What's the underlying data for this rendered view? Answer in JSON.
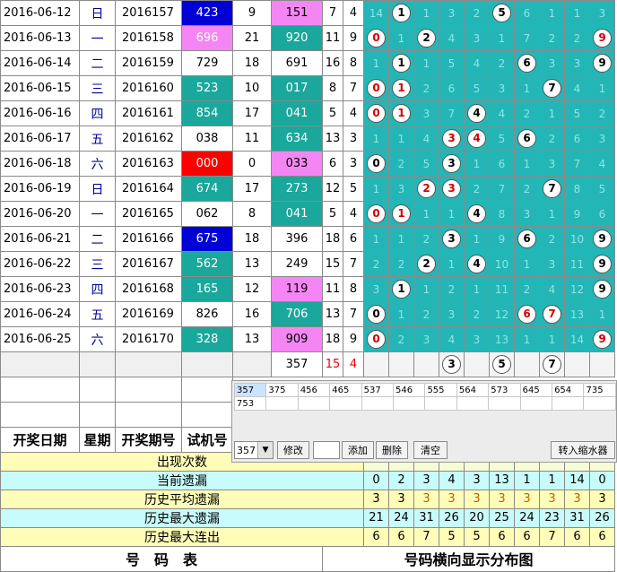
{
  "rows": [
    {
      "date": "2016-06-12",
      "week": "日",
      "issue": "2016157",
      "test": "423",
      "test_bg": "blue",
      "span": "9",
      "result": "151",
      "result_bg": "pink",
      "sum": "7",
      "hz": "4",
      "dist": [
        {
          "v": "14"
        },
        {
          "v": "1",
          "ball": true
        },
        {
          "v": "1"
        },
        {
          "v": "3"
        },
        {
          "v": "2"
        },
        {
          "v": "5",
          "ball": true
        },
        {
          "v": "6"
        },
        {
          "v": "1"
        },
        {
          "v": "1"
        },
        {
          "v": "3"
        }
      ]
    },
    {
      "date": "2016-06-13",
      "week": "一",
      "issue": "2016158",
      "test": "696",
      "test_bg": "pink",
      "span": "21",
      "result": "920",
      "result_bg": "teal",
      "sum": "11",
      "hz": "9",
      "dist": [
        {
          "v": "0",
          "ball": true,
          "red": true
        },
        {
          "v": "1"
        },
        {
          "v": "2",
          "ball": true
        },
        {
          "v": "4"
        },
        {
          "v": "3"
        },
        {
          "v": "1"
        },
        {
          "v": "7"
        },
        {
          "v": "2"
        },
        {
          "v": "2"
        },
        {
          "v": "9",
          "ball": true,
          "red": true
        }
      ]
    },
    {
      "date": "2016-06-14",
      "week": "二",
      "issue": "2016159",
      "test": "729",
      "test_bg": "white",
      "span": "18",
      "result": "691",
      "result_bg": "white",
      "sum": "16",
      "hz": "8",
      "dist": [
        {
          "v": "1"
        },
        {
          "v": "1",
          "ball": true
        },
        {
          "v": "1"
        },
        {
          "v": "5"
        },
        {
          "v": "4"
        },
        {
          "v": "2"
        },
        {
          "v": "6",
          "ball": true
        },
        {
          "v": "3"
        },
        {
          "v": "3"
        },
        {
          "v": "9",
          "ball": true
        }
      ]
    },
    {
      "date": "2016-06-15",
      "week": "三",
      "issue": "2016160",
      "test": "523",
      "test_bg": "teal",
      "span": "10",
      "result": "017",
      "result_bg": "teal",
      "sum": "8",
      "hz": "7",
      "dist": [
        {
          "v": "0",
          "ball": true,
          "red": true
        },
        {
          "v": "1",
          "ball": true,
          "red": true
        },
        {
          "v": "2"
        },
        {
          "v": "6"
        },
        {
          "v": "5"
        },
        {
          "v": "3"
        },
        {
          "v": "1"
        },
        {
          "v": "7",
          "ball": true
        },
        {
          "v": "4"
        },
        {
          "v": "1"
        }
      ]
    },
    {
      "date": "2016-06-16",
      "week": "四",
      "issue": "2016161",
      "test": "854",
      "test_bg": "teal",
      "span": "17",
      "result": "041",
      "result_bg": "teal",
      "sum": "5",
      "hz": "4",
      "dist": [
        {
          "v": "0",
          "ball": true,
          "red": true
        },
        {
          "v": "1",
          "ball": true,
          "red": true
        },
        {
          "v": "3"
        },
        {
          "v": "7"
        },
        {
          "v": "4",
          "ball": true
        },
        {
          "v": "4"
        },
        {
          "v": "2"
        },
        {
          "v": "1"
        },
        {
          "v": "5"
        },
        {
          "v": "2"
        }
      ]
    },
    {
      "date": "2016-06-17",
      "week": "五",
      "issue": "2016162",
      "test": "038",
      "test_bg": "white",
      "span": "11",
      "result": "634",
      "result_bg": "teal",
      "sum": "13",
      "hz": "3",
      "dist": [
        {
          "v": "1"
        },
        {
          "v": "1"
        },
        {
          "v": "4"
        },
        {
          "v": "3",
          "ball": true,
          "red": true
        },
        {
          "v": "4",
          "ball": true,
          "red": true
        },
        {
          "v": "5"
        },
        {
          "v": "6",
          "ball": true
        },
        {
          "v": "2"
        },
        {
          "v": "6"
        },
        {
          "v": "3"
        }
      ]
    },
    {
      "date": "2016-06-18",
      "week": "六",
      "issue": "2016163",
      "test": "000",
      "test_bg": "red",
      "span": "0",
      "result": "033",
      "result_bg": "pink",
      "sum": "6",
      "hz": "3",
      "dist": [
        {
          "v": "0",
          "ball": true
        },
        {
          "v": "2"
        },
        {
          "v": "5"
        },
        {
          "v": "3",
          "ball": true
        },
        {
          "v": "1"
        },
        {
          "v": "6"
        },
        {
          "v": "1"
        },
        {
          "v": "3"
        },
        {
          "v": "7"
        },
        {
          "v": "4"
        }
      ]
    },
    {
      "date": "2016-06-19",
      "week": "日",
      "issue": "2016164",
      "test": "674",
      "test_bg": "teal",
      "span": "17",
      "result": "273",
      "result_bg": "teal",
      "sum": "12",
      "hz": "5",
      "dist": [
        {
          "v": "1"
        },
        {
          "v": "3"
        },
        {
          "v": "2",
          "ball": true,
          "red": true
        },
        {
          "v": "3",
          "ball": true,
          "red": true
        },
        {
          "v": "2"
        },
        {
          "v": "7"
        },
        {
          "v": "2"
        },
        {
          "v": "7",
          "ball": true
        },
        {
          "v": "8"
        },
        {
          "v": "5"
        }
      ]
    },
    {
      "date": "2016-06-20",
      "week": "一",
      "issue": "2016165",
      "test": "062",
      "test_bg": "white",
      "span": "8",
      "result": "041",
      "result_bg": "teal",
      "sum": "5",
      "hz": "4",
      "dist": [
        {
          "v": "0",
          "ball": true,
          "red": true
        },
        {
          "v": "1",
          "ball": true,
          "red": true
        },
        {
          "v": "1"
        },
        {
          "v": "1"
        },
        {
          "v": "4",
          "ball": true
        },
        {
          "v": "8"
        },
        {
          "v": "3"
        },
        {
          "v": "1"
        },
        {
          "v": "9"
        },
        {
          "v": "6"
        }
      ]
    },
    {
      "date": "2016-06-21",
      "week": "二",
      "issue": "2016166",
      "test": "675",
      "test_bg": "blue",
      "span": "18",
      "result": "396",
      "result_bg": "white",
      "sum": "18",
      "hz": "6",
      "dist": [
        {
          "v": "1"
        },
        {
          "v": "1"
        },
        {
          "v": "2"
        },
        {
          "v": "3",
          "ball": true
        },
        {
          "v": "1"
        },
        {
          "v": "9"
        },
        {
          "v": "6",
          "ball": true
        },
        {
          "v": "2"
        },
        {
          "v": "10"
        },
        {
          "v": "9",
          "ball": true
        }
      ]
    },
    {
      "date": "2016-06-22",
      "week": "三",
      "issue": "2016167",
      "test": "562",
      "test_bg": "teal",
      "span": "13",
      "result": "249",
      "result_bg": "white",
      "sum": "15",
      "hz": "7",
      "dist": [
        {
          "v": "2"
        },
        {
          "v": "2"
        },
        {
          "v": "2",
          "ball": true
        },
        {
          "v": "1"
        },
        {
          "v": "4",
          "ball": true
        },
        {
          "v": "10"
        },
        {
          "v": "1"
        },
        {
          "v": "3"
        },
        {
          "v": "11"
        },
        {
          "v": "9",
          "ball": true
        }
      ]
    },
    {
      "date": "2016-06-23",
      "week": "四",
      "issue": "2016168",
      "test": "165",
      "test_bg": "teal",
      "span": "12",
      "result": "119",
      "result_bg": "pink",
      "sum": "11",
      "hz": "8",
      "dist": [
        {
          "v": "3"
        },
        {
          "v": "1",
          "ball": true
        },
        {
          "v": "1"
        },
        {
          "v": "2"
        },
        {
          "v": "1"
        },
        {
          "v": "11"
        },
        {
          "v": "2"
        },
        {
          "v": "4"
        },
        {
          "v": "12"
        },
        {
          "v": "9",
          "ball": true
        }
      ]
    },
    {
      "date": "2016-06-24",
      "week": "五",
      "issue": "2016169",
      "test": "826",
      "test_bg": "white",
      "span": "16",
      "result": "706",
      "result_bg": "teal",
      "sum": "13",
      "hz": "7",
      "dist": [
        {
          "v": "0",
          "ball": true
        },
        {
          "v": "1"
        },
        {
          "v": "2"
        },
        {
          "v": "3"
        },
        {
          "v": "2"
        },
        {
          "v": "12"
        },
        {
          "v": "6",
          "ball": true,
          "red": true
        },
        {
          "v": "7",
          "ball": true,
          "red": true
        },
        {
          "v": "13"
        },
        {
          "v": "1"
        }
      ]
    },
    {
      "date": "2016-06-25",
      "week": "六",
      "issue": "2016170",
      "test": "328",
      "test_bg": "teal",
      "span": "13",
      "result": "909",
      "result_bg": "pink",
      "sum": "18",
      "hz": "9",
      "dist": [
        {
          "v": "0",
          "ball": true,
          "red": true
        },
        {
          "v": "2"
        },
        {
          "v": "3"
        },
        {
          "v": "4"
        },
        {
          "v": "3"
        },
        {
          "v": "13"
        },
        {
          "v": "1"
        },
        {
          "v": "1"
        },
        {
          "v": "14"
        },
        {
          "v": "9",
          "ball": true,
          "red": true
        }
      ]
    }
  ],
  "next_row": {
    "result": "357",
    "sum": "15",
    "hz": "4",
    "dist": [
      {
        "v": ""
      },
      {
        "v": ""
      },
      {
        "v": ""
      },
      {
        "v": "3",
        "ball": true
      },
      {
        "v": ""
      },
      {
        "v": "5",
        "ball": true
      },
      {
        "v": ""
      },
      {
        "v": "7",
        "ball": true
      },
      {
        "v": ""
      },
      {
        "v": ""
      }
    ]
  },
  "headers": {
    "date": "开奖日期",
    "week": "星期",
    "issue": "开奖期号",
    "test": "试机号"
  },
  "stats": [
    {
      "label": "出现次数",
      "cls": "yellow",
      "values": [
        "",
        "",
        "",
        "",
        "",
        "",
        "",
        "",
        "",
        ""
      ]
    },
    {
      "label": "当前遗漏",
      "cls": "cyan",
      "values": [
        "0",
        "2",
        "3",
        "4",
        "3",
        "13",
        "1",
        "1",
        "14",
        "0"
      ]
    },
    {
      "label": "历史平均遗漏",
      "cls": "yellow",
      "values": [
        "3",
        "3",
        "3",
        "3",
        "3",
        "3",
        "3",
        "3",
        "3",
        "3"
      ]
    },
    {
      "label": "历史最大遗漏",
      "cls": "cyan",
      "values": [
        "21",
        "24",
        "31",
        "26",
        "20",
        "25",
        "24",
        "23",
        "31",
        "26"
      ]
    },
    {
      "label": "历史最大连出",
      "cls": "yellow",
      "values": [
        "6",
        "6",
        "7",
        "5",
        "5",
        "6",
        "6",
        "7",
        "6",
        "6"
      ]
    }
  ],
  "footer": {
    "left": "号　码　表",
    "right": "号码横向显示分布图"
  },
  "panel": {
    "numbers_row1": [
      "357",
      "375",
      "456",
      "465",
      "537",
      "546",
      "555",
      "564",
      "573",
      "645",
      "654",
      "735"
    ],
    "numbers_row2": [
      "753",
      "",
      "",
      "",
      "",
      "",
      "",
      "",
      "",
      "",
      "",
      ""
    ],
    "select_value": "357",
    "modify_label": "修改",
    "input_value": "",
    "add_label": "添加",
    "delete_label": "删除",
    "clear_label": "清空",
    "shrink_label": "转入缩水器"
  },
  "colors": {
    "teal": "#1aa79c",
    "pink": "#f486f4",
    "blue": "#0000d6",
    "red": "#ff0000",
    "dist": "#24b6b6",
    "ball_red": "#d00000"
  }
}
